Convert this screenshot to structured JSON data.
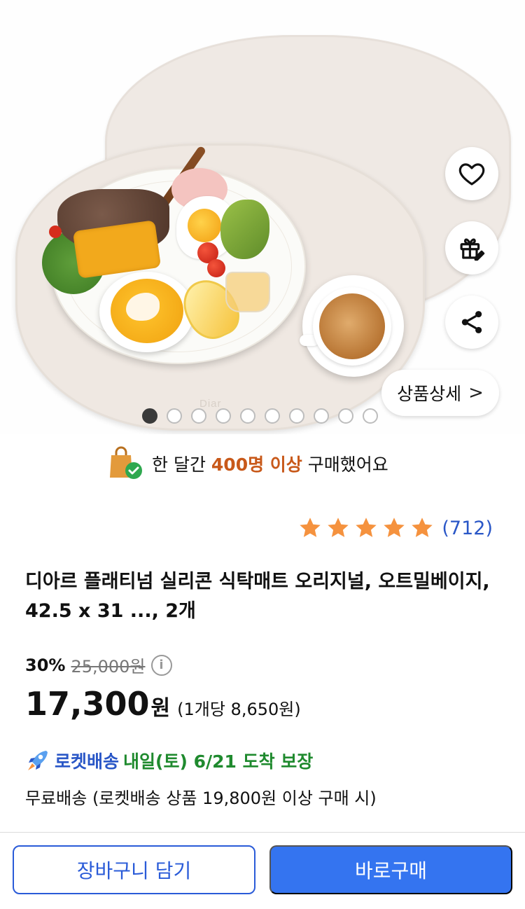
{
  "hero": {
    "mat_logo": "Diar",
    "detail_button": {
      "label": "상품상세",
      "chevron": ">"
    },
    "actions": [
      {
        "name": "heart-icon"
      },
      {
        "name": "gift-icon"
      },
      {
        "name": "share-icon"
      }
    ],
    "carousel": {
      "total": 10,
      "active_index": 0
    }
  },
  "purchase_banner": {
    "icon": "shopping-bag-check-icon",
    "prefix": "한 달간 ",
    "highlight": "400명 이상",
    "suffix": " 구매했어요",
    "highlight_color": "#c8591a"
  },
  "rating": {
    "stars": 5,
    "count": "(712)",
    "star_color": "#f5923e"
  },
  "product": {
    "title": "디아르 플래티넘 실리콘 식탁매트 오리지널, 오트밀베이지, 42.5 x 31 ..., 2개"
  },
  "price": {
    "discount": "30%",
    "original": "25,000원",
    "info_icon": "i",
    "current": "17,300",
    "currency": "원",
    "unit_price": "(1개당 8,650원)"
  },
  "shipping": {
    "rocket_label": "로켓배송",
    "arrival": "내일(토) 6/21 도착 보장",
    "free_shipping": "무료배송 (로켓배송 상품 19,800원 이상 구매 시)"
  },
  "bottom_bar": {
    "cart_button": "장바구니 담기",
    "buy_button": "바로구매"
  },
  "colors": {
    "primary": "#3474f0",
    "rocket": "#2a57c7",
    "arrival": "#1f8a2e"
  }
}
